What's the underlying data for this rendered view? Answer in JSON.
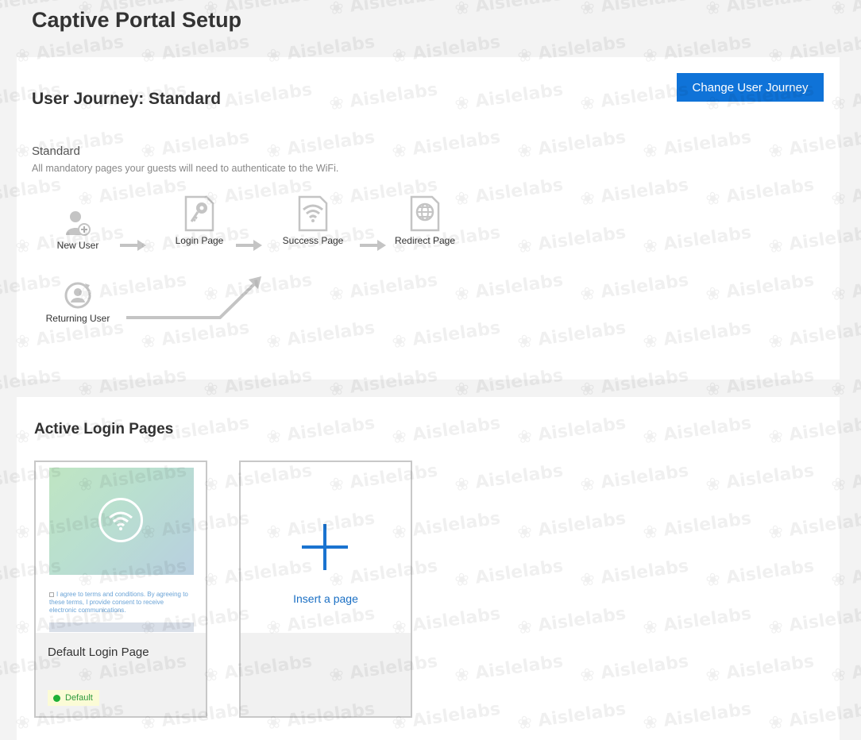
{
  "page": {
    "title": "Captive Portal Setup"
  },
  "journey": {
    "title": "User Journey: Standard",
    "change_button": "Change User Journey",
    "section_title": "Standard",
    "section_desc": "All mandatory pages your guests will need to authenticate to the WiFi.",
    "steps": [
      {
        "label": "New User",
        "icon": "new-user-icon"
      },
      {
        "label": "Login Page",
        "icon": "key-page-icon"
      },
      {
        "label": "Success Page",
        "icon": "wifi-page-icon"
      },
      {
        "label": "Redirect Page",
        "icon": "globe-page-icon"
      }
    ],
    "returning": {
      "label": "Returning User",
      "icon": "returning-user-icon"
    }
  },
  "login_pages": {
    "title": "Active Login Pages",
    "pages": [
      {
        "name": "Default Login Page",
        "badge": "Default",
        "terms_text": "I agree to terms and conditions. By agreeing to these terms, I provide consent to receive electronic communications."
      }
    ],
    "insert_label": "Insert a page"
  },
  "colors": {
    "accent": "#0f73d8",
    "badge_green": "#1db035",
    "badge_bg": "#fbfbd6"
  },
  "watermark": "Aislelabs"
}
